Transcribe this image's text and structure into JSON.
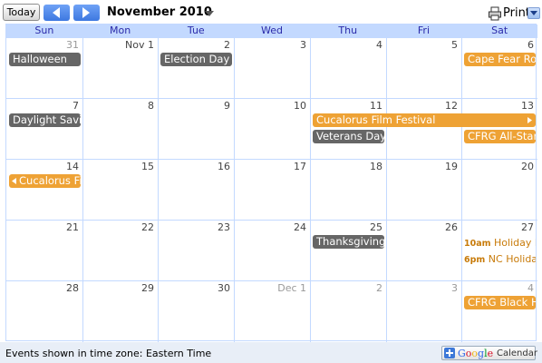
{
  "toolbar": {
    "today_label": "Today",
    "month_title": "November 2010",
    "print_label": "Print"
  },
  "days_of_week": [
    "Sun",
    "Mon",
    "Tue",
    "Wed",
    "Thu",
    "Fri",
    "Sat"
  ],
  "weeks": [
    {
      "days": [
        "31",
        "Nov 1",
        "2",
        "3",
        "4",
        "5",
        "6"
      ],
      "dim": [
        true,
        false,
        false,
        false,
        false,
        false,
        false
      ],
      "events": [
        {
          "label": "Halloween",
          "color": "gray",
          "start": 0,
          "span": 1,
          "row": 0
        },
        {
          "label": "Election Day",
          "color": "gray",
          "start": 2,
          "span": 1,
          "row": 0
        },
        {
          "label": "Cape Fear Ro",
          "color": "orange",
          "start": 6,
          "span": 1,
          "row": 0
        }
      ]
    },
    {
      "days": [
        "7",
        "8",
        "9",
        "10",
        "11",
        "12",
        "13"
      ],
      "dim": [
        false,
        false,
        false,
        false,
        false,
        false,
        false
      ],
      "events": [
        {
          "label": "Daylight Savi",
          "color": "gray",
          "start": 0,
          "span": 1,
          "row": 0
        },
        {
          "label": "Cucalorus Film Festival",
          "color": "orange",
          "start": 4,
          "span": 3,
          "row": 0,
          "continues_right": true
        },
        {
          "label": "Veterans Day",
          "color": "gray",
          "start": 4,
          "span": 1,
          "row": 1
        },
        {
          "label": "CFRG All-Star",
          "color": "orange",
          "start": 6,
          "span": 1,
          "row": 1
        }
      ]
    },
    {
      "days": [
        "14",
        "15",
        "16",
        "17",
        "18",
        "19",
        "20"
      ],
      "dim": [
        false,
        false,
        false,
        false,
        false,
        false,
        false
      ],
      "events": [
        {
          "label": "Cucalorus Fi",
          "color": "orange",
          "start": 0,
          "span": 1,
          "row": 0,
          "continues_left": true
        }
      ]
    },
    {
      "days": [
        "21",
        "22",
        "23",
        "24",
        "25",
        "26",
        "27"
      ],
      "dim": [
        false,
        false,
        false,
        false,
        false,
        false,
        false
      ],
      "events": [
        {
          "label": "Thanksgiving",
          "color": "gray",
          "start": 4,
          "span": 1,
          "row": 0
        }
      ],
      "timed_events": [
        {
          "time": "10am",
          "label": "Holiday F",
          "start": 6,
          "row": 0
        },
        {
          "time": "6pm",
          "label": "NC Holida",
          "start": 6,
          "row": 1
        }
      ]
    },
    {
      "days": [
        "28",
        "29",
        "30",
        "Dec 1",
        "2",
        "3",
        "4"
      ],
      "dim": [
        false,
        false,
        false,
        true,
        true,
        true,
        true
      ],
      "events": [
        {
          "label": "CFRG Black H",
          "color": "orange",
          "start": 6,
          "span": 1,
          "row": 0
        }
      ]
    }
  ],
  "footer": {
    "timezone_text": "Events shown in time zone: Eastern Time",
    "google_logo": "Google",
    "calendar_word": "Calendar"
  },
  "colors": {
    "grid_border": "#c3d9ff",
    "event_gray": "#666666",
    "event_orange": "#eea235",
    "timed_text": "#c87b0a",
    "nav_blue": "#3d78e0"
  }
}
